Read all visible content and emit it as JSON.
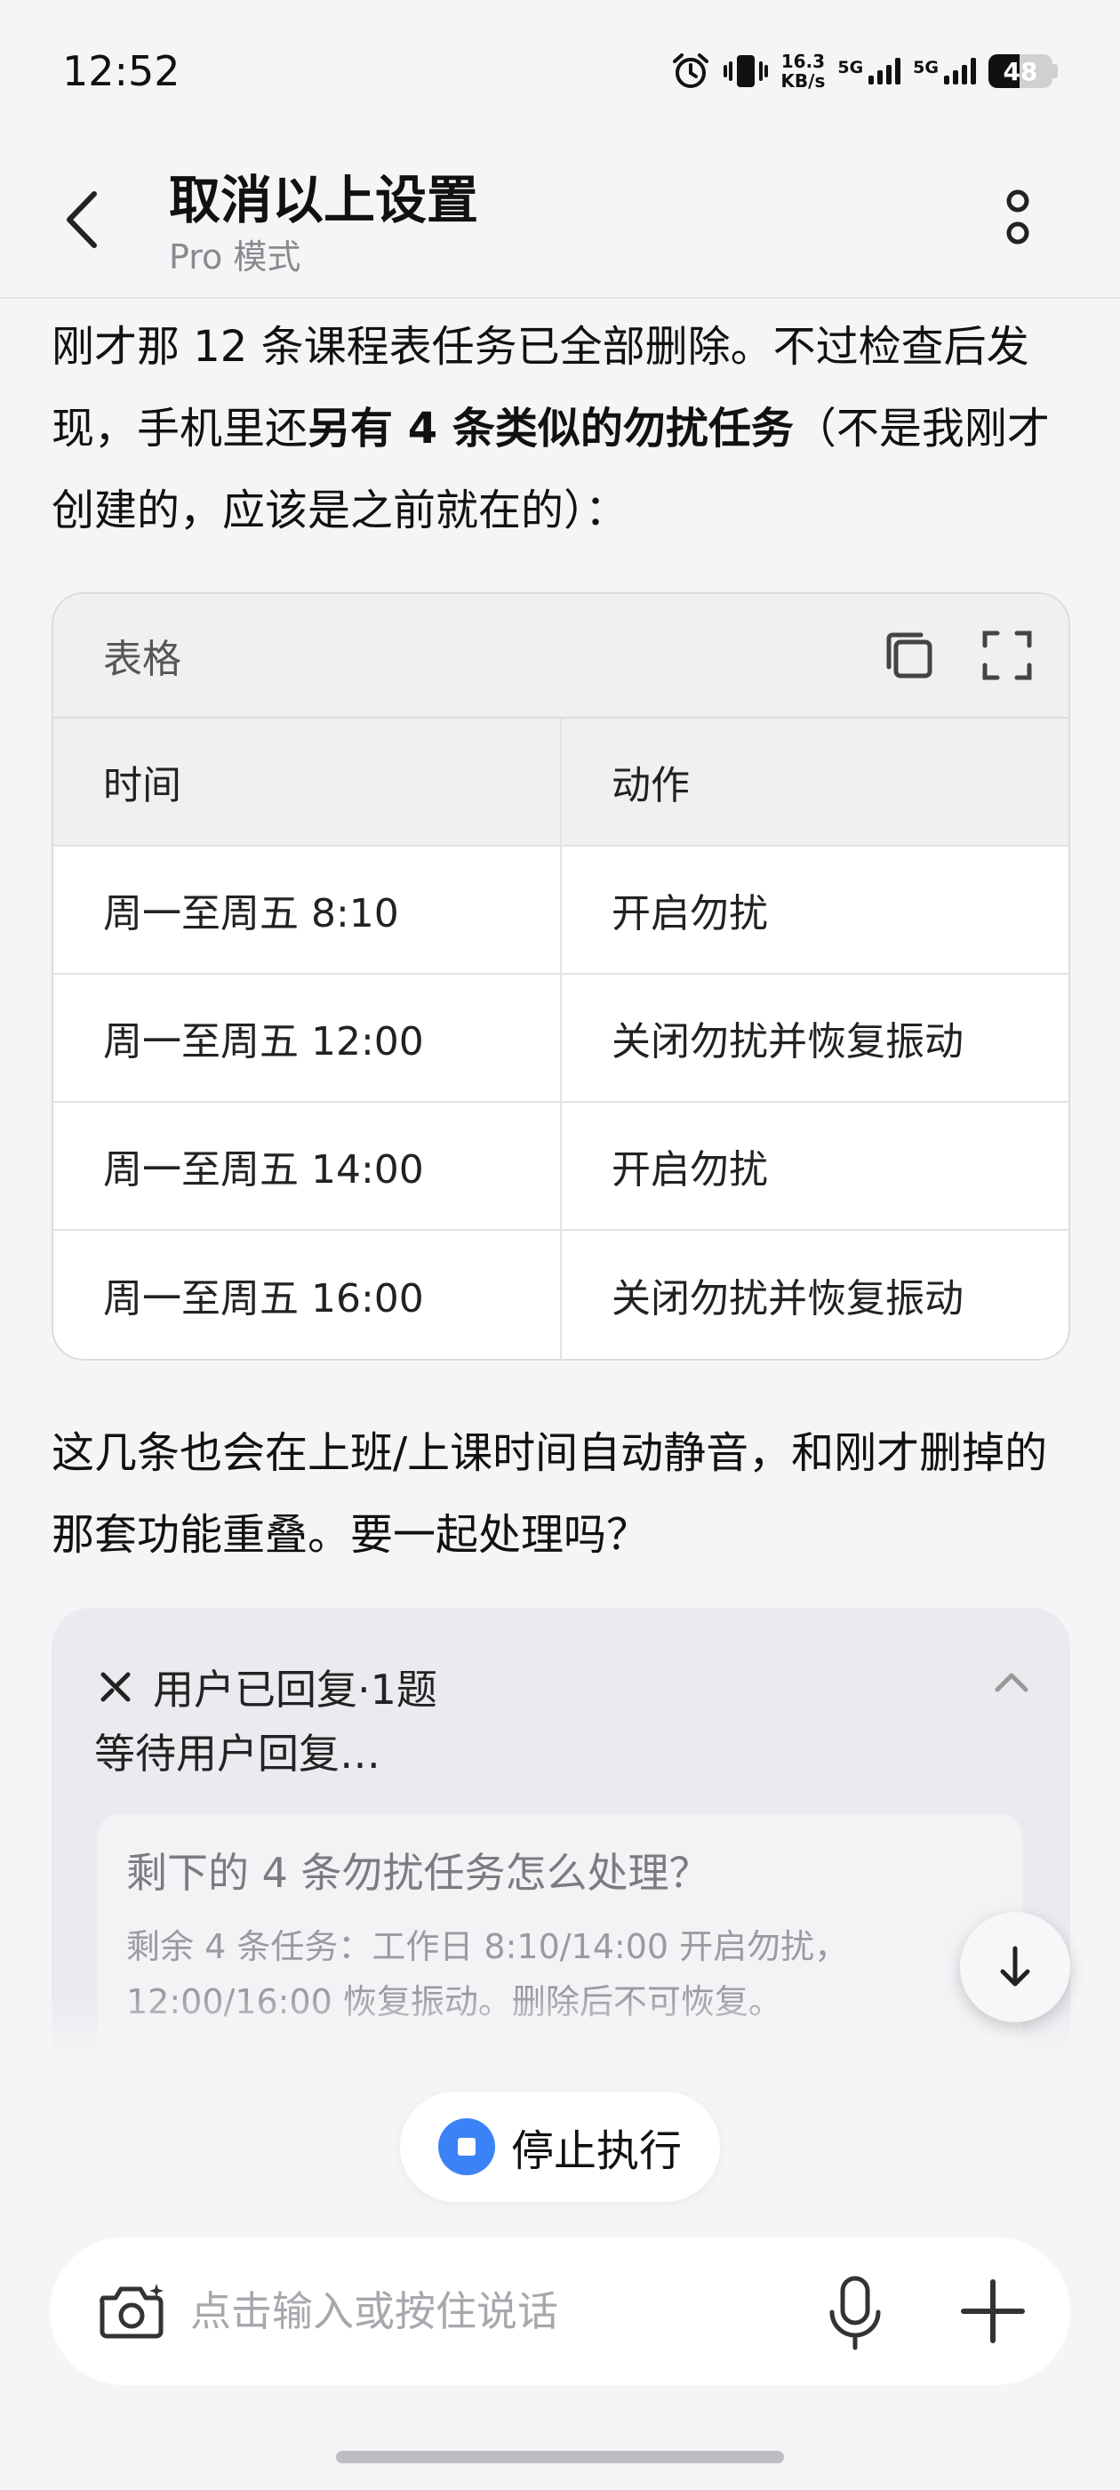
{
  "status_bar": {
    "time": "12:52",
    "net_speed_value": "16.3",
    "net_speed_unit": "KB/s",
    "sim1_label": "5G",
    "sim2_label": "5G",
    "battery_level": "48",
    "battery_fraction": 0.48
  },
  "header": {
    "title": "取消以上设置",
    "subtitle": "Pro 模式"
  },
  "message": {
    "intro_part1": "刚才那 12 条课程表任务已全部删除。不过检查后发现，手机里还",
    "intro_bold": "另有 4 条类似的勿扰任务",
    "intro_part2": "（不是我刚才创建的，应该是之前就在的）：",
    "table": {
      "label": "表格",
      "columns": [
        "时间",
        "动作"
      ],
      "rows": [
        [
          "周一至周五 8:10",
          "开启勿扰"
        ],
        [
          "周一至周五 12:00",
          "关闭勿扰并恢复振动"
        ],
        [
          "周一至周五 14:00",
          "开启勿扰"
        ],
        [
          "周一至周五 16:00",
          "关闭勿扰并恢复振动"
        ]
      ]
    },
    "followup": "这几条也会在上班/上课时间自动静音，和刚才删掉的那套功能重叠。要一起处理吗？"
  },
  "reply_card": {
    "title": "用户已回复·1题",
    "status": "等待用户回复…",
    "question_title": "剩下的 4 条勿扰任务怎么处理？",
    "question_desc": "剩余 4 条任务：工作日 8:10/14:00 开启勿扰，12:00/16:00 恢复振动。删除后不可恢复。"
  },
  "stop_button": {
    "label": "停止执行"
  },
  "input_bar": {
    "placeholder": "点击输入或按住说话"
  },
  "colors": {
    "accent": "#3b82f6",
    "background": "#f5f5f7"
  }
}
